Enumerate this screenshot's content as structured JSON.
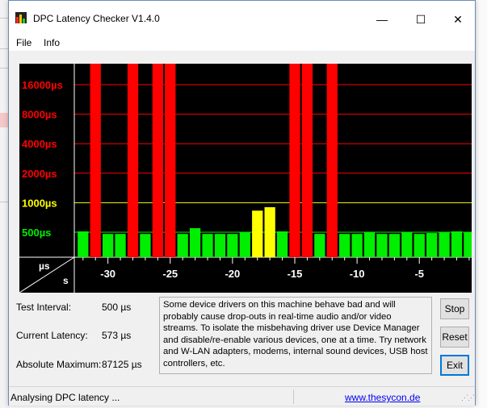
{
  "window": {
    "title": "DPC Latency Checker V1.4.0",
    "controls": {
      "minimize": "—",
      "maximize": "☐",
      "close": "✕"
    }
  },
  "menu": {
    "file": "File",
    "info": "Info"
  },
  "colors": {
    "high": "#ff0000",
    "medium": "#ffff00",
    "low": "#00ee00",
    "background": "#000000"
  },
  "chart_data": {
    "type": "bar",
    "yscale": "log",
    "y_ticks": [
      {
        "label": "16000µs",
        "value": 16000,
        "color": "#ff0000"
      },
      {
        "label": "8000µs",
        "value": 8000,
        "color": "#ff0000"
      },
      {
        "label": "4000µs",
        "value": 4000,
        "color": "#ff0000"
      },
      {
        "label": "2000µs",
        "value": 2000,
        "color": "#ff0000"
      },
      {
        "label": "1000µs",
        "value": 1000,
        "color": "#ffff00"
      },
      {
        "label": "500µs",
        "value": 500,
        "color": "#00ee00"
      }
    ],
    "corner_y_unit": "µs",
    "corner_x_unit": "s",
    "x_ticks": [
      {
        "label": "-30",
        "value": -30
      },
      {
        "label": "-25",
        "value": -25
      },
      {
        "label": "-20",
        "value": -20
      },
      {
        "label": "-15",
        "value": -15
      },
      {
        "label": "-10",
        "value": -10
      },
      {
        "label": "-5",
        "value": -5
      }
    ],
    "x": [
      -32,
      -31,
      -30,
      -29,
      -28,
      -27,
      -26,
      -25,
      -24,
      -23,
      -22,
      -21,
      -20,
      -19,
      -18,
      -17,
      -16,
      -15,
      -14,
      -13,
      -12,
      -11,
      -10,
      -9,
      -8,
      -7,
      -6,
      -5,
      -4,
      -3,
      -2,
      -1
    ],
    "values": [
      510,
      70000,
      480,
      480,
      70000,
      480,
      70000,
      70000,
      480,
      550,
      480,
      480,
      480,
      500,
      830,
      900,
      510,
      70000,
      70000,
      480,
      70000,
      480,
      480,
      500,
      480,
      480,
      500,
      480,
      490,
      500,
      510,
      500
    ]
  },
  "stats": {
    "test_interval_label": "Test Interval:",
    "test_interval_value": "500 µs",
    "current_latency_label": "Current Latency:",
    "current_latency_value": "573 µs",
    "absolute_maximum_label": "Absolute Maximum:",
    "absolute_maximum_value": "87125 µs"
  },
  "message": "Some device drivers on this machine behave bad and will probably cause drop-outs in real-time audio and/or video streams. To isolate the misbehaving driver use Device Manager and disable/re-enable various devices, one at a time. Try network and W-LAN adapters, modems, internal sound devices, USB host controllers, etc.",
  "buttons": {
    "stop": "Stop",
    "reset": "Reset",
    "exit": "Exit"
  },
  "status": {
    "text": "Analysing DPC latency ...",
    "link": "www.thesycon.de"
  }
}
